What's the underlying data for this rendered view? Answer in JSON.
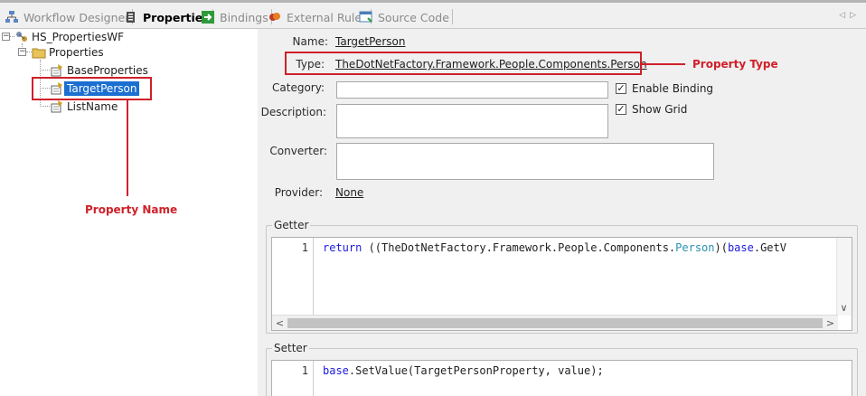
{
  "tabs": [
    {
      "label": "Workflow Designer",
      "icon": "workflow-icon",
      "active": false
    },
    {
      "label": "Properties",
      "icon": "properties-icon",
      "active": true
    },
    {
      "label": "Bindings",
      "icon": "bindings-icon",
      "active": false
    },
    {
      "label": "External Rules",
      "icon": "rules-icon",
      "active": false
    },
    {
      "label": "Source Code",
      "icon": "source-code-icon",
      "active": false
    }
  ],
  "tab_nav": {
    "prev": "◁",
    "next": "▷"
  },
  "tree": {
    "root": "HS_PropertiesWF",
    "folder": "Properties",
    "items": [
      "BaseProperties",
      "TargetPerson",
      "ListName"
    ],
    "selected": "TargetPerson",
    "expander_minus": "−"
  },
  "form": {
    "name_label": "Name:",
    "name_value": "TargetPerson",
    "type_label": "Type:",
    "type_value": "TheDotNetFactory.Framework.People.Components.Person",
    "category_label": "Category:",
    "category_value": "",
    "description_label": "Description:",
    "description_value": "",
    "converter_label": "Converter:",
    "converter_value": "",
    "provider_label": "Provider:",
    "provider_value": "None",
    "enable_binding_label": "Enable Binding",
    "enable_binding_checked": true,
    "show_grid_label": "Show Grid",
    "show_grid_checked": true,
    "check_mark": "✓"
  },
  "getter": {
    "title": "Getter",
    "line_number": "1",
    "code_kw": "return",
    "code_prefix": " ((TheDotNetFactory.Framework.People.Components.",
    "code_type": "Person",
    "code_mid": ")(",
    "code_kw2": "base",
    "code_suffix": ".GetV"
  },
  "setter": {
    "title": "Setter",
    "line_number": "1",
    "code_kw": "base",
    "code_rest": ".SetValue(TargetPersonProperty, value);"
  },
  "scroll": {
    "left": "<",
    "right": ">",
    "up": "∧",
    "down": "∨"
  },
  "annotations": {
    "property_type": "Property Type",
    "property_name": "Property Name"
  },
  "colors": {
    "annotation": "#d0202a",
    "selection": "#1a6fd1"
  }
}
